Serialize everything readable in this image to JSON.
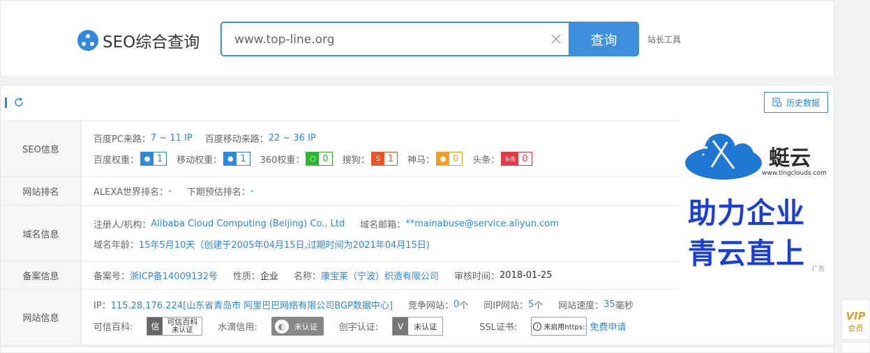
{
  "header": {
    "logo_text": "SEO综合查询",
    "search_value": "www.top-line.org",
    "search_button": "查询",
    "tool_link": "站长工具"
  },
  "toolbar": {
    "history_button": "历史数据"
  },
  "seo": {
    "label": "SEO信息",
    "pc_traffic_label": "百度PC来路：",
    "pc_traffic_value": "7 ~ 11 IP",
    "mobile_traffic_label": "百度移动来路：",
    "mobile_traffic_value": "22 ~ 36 IP",
    "weights": [
      {
        "label": "百度权重：",
        "value": "1",
        "color": "#2f88dc",
        "icon": "baidu-paw-icon"
      },
      {
        "label": "移动权重：",
        "value": "1",
        "color": "#2f88dc",
        "icon": "baidu-paw-icon"
      },
      {
        "label": "360权重：",
        "value": "0",
        "color": "#2fb433",
        "icon": "360-icon"
      },
      {
        "label": "搜狗：",
        "value": "1",
        "color": "#e8552c",
        "icon": "sogou-icon"
      },
      {
        "label": "神马：",
        "value": "0",
        "color": "#f0a02a",
        "icon": "shenma-icon"
      },
      {
        "label": "头条：",
        "value": "0",
        "color": "#e23b47",
        "icon": "toutiao-icon"
      }
    ],
    "toutiao_icon_text": "头条"
  },
  "rank": {
    "label": "网站排名",
    "alexa_label": "ALEXA世界排名：",
    "alexa_value": "-",
    "forecast_label": "下期预估排名：",
    "forecast_value": "-"
  },
  "domain": {
    "label": "域名信息",
    "registrant_label": "注册人/机构：",
    "registrant_value": "Alibaba Cloud Computing (Beijing) Co., Ltd",
    "email_label": "域名邮箱：",
    "email_value": "**mainabuse@service.aliyun.com",
    "age_label": "域名年龄：",
    "age_value": "15年5月10天（创建于2005年04月15日,过期时间为2021年04月15日)"
  },
  "icp": {
    "label": "备案信息",
    "number_label": "备案号：",
    "number_value": "浙ICP备14009132号",
    "nature_label": "性质：",
    "nature_value": "企业",
    "name_label": "名称：",
    "name_value": "康宝莱（宁波）织造有限公司",
    "audit_label": "审核时间：",
    "audit_value": "2018-01-25"
  },
  "site": {
    "label": "网站信息",
    "ip_label": "IP：",
    "ip_value": "115.28.176.224[山东省青岛市 阿里巴巴网络有限公司BGP数据中心]",
    "competitor_label": "竞争网站：",
    "competitor_value": "0",
    "same_ip_label": "同IP网站：",
    "same_ip_value": "5",
    "speed_label": "网站速度：",
    "speed_value": "35",
    "unit_ge": "个",
    "unit_ms": "毫秒",
    "kxbk_label": "可信百科:",
    "kxbk_title": "可信百科",
    "kxbk_status": "未认证",
    "shuidi_label": "水滴信用:",
    "shuidi_status": "未认证",
    "chuangyu_label": "创宇认证:",
    "chuangyu_status": "未认证",
    "ssl_label": "SSL证书:",
    "ssl_status": "未启用https:",
    "ssl_apply": "免费申请"
  },
  "ad": {
    "brand": "蜓云",
    "url": "www.tingclouds.com",
    "line1": "助力企业",
    "line2": "青云直上",
    "tag": "广告"
  },
  "side": {
    "vip_logo": "VIP",
    "vip_label": "会员"
  }
}
